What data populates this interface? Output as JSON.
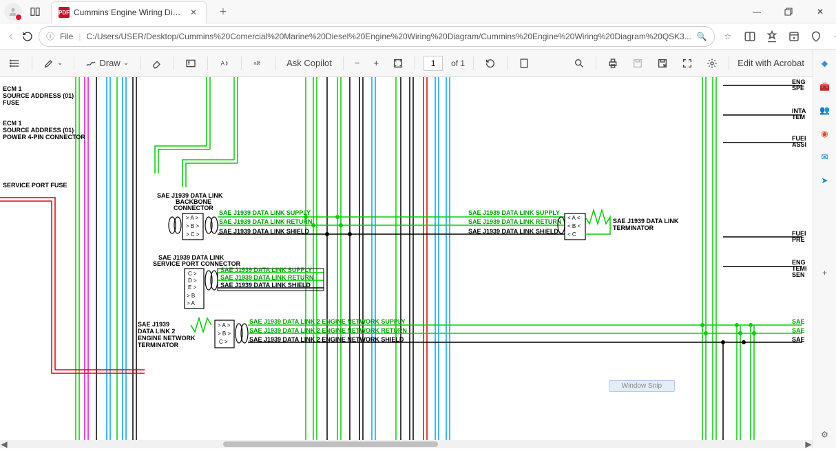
{
  "window": {
    "tab_title": "Cummins Engine Wiring Diagram",
    "close": "✕",
    "minimize": "—",
    "maximize": "▢"
  },
  "address": {
    "file_label": "File",
    "url": "C:/Users/USER/Desktop/Cummins%20Comercial%20Marine%20Diesel%20Engine%20Wiring%20Diagram/Cummins%20Engine%20Wiring%20Diagram%20QSK3..."
  },
  "pdfbar": {
    "draw": "Draw",
    "ask_copilot": "Ask Copilot",
    "page_current": "1",
    "page_total": "of 1",
    "edit_acrobat": "Edit with Acrobat"
  },
  "diagram": {
    "ecm1_a": "ECM 1",
    "ecm1_a_line2": "SOURCE ADDRESS (01)",
    "ecm1_a_line3": "FUSE",
    "ecm1_b": "ECM 1",
    "ecm1_b_line2": "SOURCE ADDRESS (01)",
    "ecm1_b_line3": "POWER 4-PIN CONNECTOR",
    "service_port_fuse": "SERVICE PORT FUSE",
    "backbone_1": "SAE J1939 DATA LINK",
    "backbone_2": "BACKBONE",
    "backbone_3": "CONNECTOR",
    "supply": "SAE J1939 DATA LINK SUPPLY",
    "return": "SAE J1939 DATA LINK RETURN",
    "shield": "SAE J1939 DATA LINK SHIELD",
    "terminator_1": "SAE J1939 DATA LINK",
    "terminator_2": "TERMINATOR",
    "svc_port_1": "SAE J1939 DATA LINK",
    "svc_port_2": "SERVICE PORT CONNECTOR",
    "dl2_term_1": "SAE J1939",
    "dl2_term_2": "DATA LINK 2",
    "dl2_term_3": "ENGINE NETWORK",
    "dl2_term_4": "TERMINATOR",
    "dl2_supply": "SAE J1939 DATA LINK 2 ENGINE NETWORK SUPPLY",
    "dl2_return": "SAE J1939 DATA LINK 2 ENGINE NETWORK RETURN",
    "dl2_shield": "SAE J1939 DATA LINK 2 ENGINE NETWORK SHIELD",
    "right_eng": "ENG",
    "right_spe": "SPE",
    "right_inta": "INTA",
    "right_tem": "TEM",
    "right_fuei": "FUEI",
    "right_assi": "ASSI",
    "right_fuei2": "FUEI",
    "right_pre": "PRE",
    "right_eng2": "ENG",
    "right_temi": "TEMI",
    "right_sen": "SEN",
    "right_sae1": "SAE",
    "right_sae2": "SAE",
    "right_sae3": "SAE",
    "pinA": "A",
    "pinB": "B",
    "pinC": "C",
    "pinD": "D",
    "pinE": "E"
  },
  "snip": "Window Snip"
}
